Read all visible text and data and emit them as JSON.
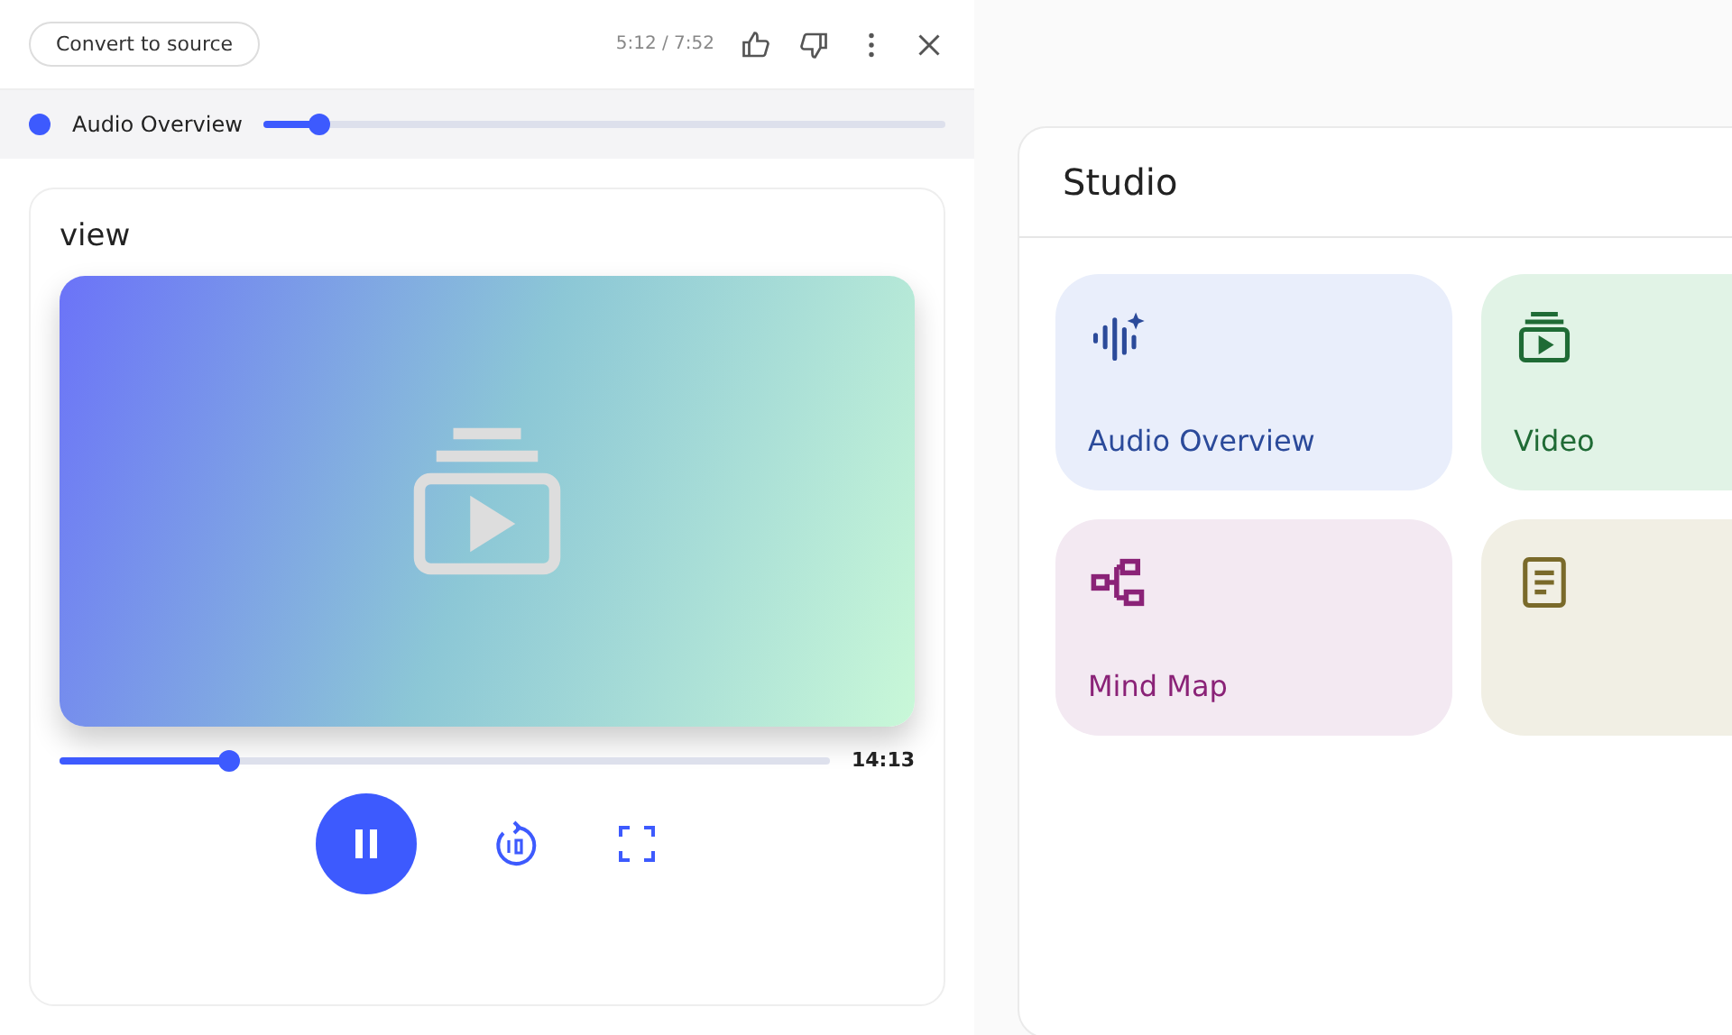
{
  "top_bar": {
    "convert_button": "Convert to source",
    "time": "5:12 / 7:52"
  },
  "audio_row": {
    "label": "Audio Overview",
    "level": 0.08
  },
  "video_panel": {
    "heading": "view",
    "duration": "14:13",
    "level": 0.22
  },
  "studio": {
    "title": "Studio",
    "cards": [
      {
        "kind": "audio",
        "label": "Audio Overview",
        "color": "#e9eefb"
      },
      {
        "kind": "video",
        "label": "Video",
        "color": "#e1f3e6"
      },
      {
        "kind": "mindmap",
        "label": "Mind Map",
        "color": "#f3e9f2"
      },
      {
        "kind": "report",
        "color": "#f1efe4"
      }
    ]
  }
}
